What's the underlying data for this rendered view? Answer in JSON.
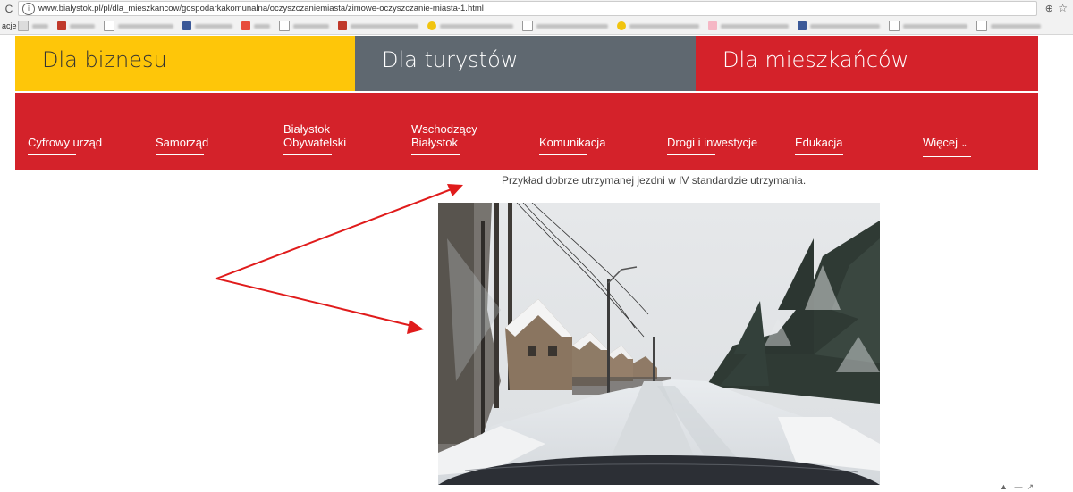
{
  "browser": {
    "url": "www.bialystok.pl/pl/dla_mieszkancow/gospodarkakomunalna/oczyszczaniemiasta/zimowe-oczyszczanie-miasta-1.html",
    "bookmarks_lead": "acje"
  },
  "top_nav": {
    "business": "Dla biznesu",
    "tourists": "Dla turystów",
    "residents": "Dla mieszkańców",
    "colors": {
      "business": "#fec609",
      "tourists": "#5f6870",
      "residents": "#d4222a"
    }
  },
  "main_nav": {
    "items": [
      {
        "line1": "Cyfrowy urząd",
        "line2": ""
      },
      {
        "line1": "Samorząd",
        "line2": ""
      },
      {
        "line1": "Białystok",
        "line2": "Obywatelski"
      },
      {
        "line1": "Wschodzący",
        "line2": "Białystok"
      },
      {
        "line1": "Komunikacja",
        "line2": ""
      },
      {
        "line1": "Drogi i inwestycje",
        "line2": ""
      },
      {
        "line1": "Edukacja",
        "line2": ""
      },
      {
        "line1": "Więcej",
        "line2": ""
      }
    ]
  },
  "content": {
    "caption": "Przykład dobrze utrzymanej jezdni w IV standardzie utrzymania."
  }
}
